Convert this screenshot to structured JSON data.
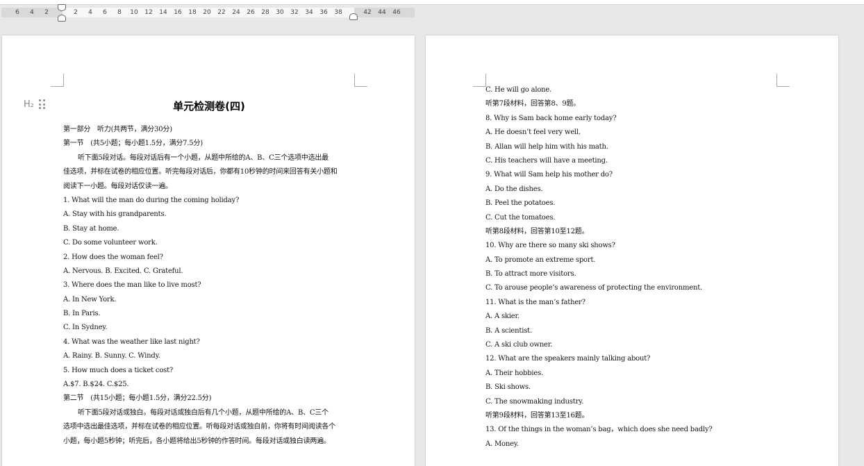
{
  "ruler": {
    "ticks": [
      "6",
      "4",
      "2",
      "2",
      "4",
      "6",
      "8",
      "10",
      "12",
      "14",
      "16",
      "18",
      "20",
      "22",
      "24",
      "26",
      "28",
      "30",
      "32",
      "34",
      "36",
      "38",
      "42",
      "44",
      "46"
    ]
  },
  "page1": {
    "heading_control": "H₂",
    "title": "单元检测卷(四)",
    "lines": [
      "第一部分　听力(共两节，满分30分)",
      "第一节　(共5小题；每小题1.5分，满分7.5分)",
      "听下面5段对话。每段对话后有一个小题，从题中所给的A、B、C三个选项中选出最",
      "佳选项，并标在试卷的相应位置。听完每段对话后，你都有10秒钟的时间来回答有关小题和",
      "阅读下一小题。每段对话仅读一遍。",
      "1.  What will the man do during the coming holiday?",
      "A.  Stay with his grandparents.",
      "B.  Stay at home.",
      "C.  Do some volunteer work.",
      "2.  How does the woman feel?",
      "A.  Nervous.    B.  Excited.    C.  Grateful.",
      "3.  Where does the man like to live most?",
      "A.  In New York.",
      "B.  In Paris.",
      "C.  In Sydney.",
      "4.  What was the weather like last night?",
      "A.  Rainy.    B.  Sunny.    C.  Windy.",
      "5.  How much does a ticket cost?",
      "A.$7.    B.$24.    C.$25.",
      "第二节　(共15小题；每小题1.5分，满分22.5分)",
      "听下面5段对话或独白。每段对话或独白后有几个小题，从题中所给的A、B、C三个",
      "选项中选出最佳选项，并标在试卷的相应位置。听每段对话或独白前，你将有时间阅读各个",
      "小题，每小题5秒钟；听完后，各小题将给出5秒钟的作答时间。每段对话或独白读两遍。"
    ]
  },
  "page2": {
    "lines": [
      "C.  He will go alone.",
      "听第7段材料，回答第8、9题。",
      "8.  Why is Sam back home early today?",
      "A.  He doesn’t feel very well.",
      "B.  Allan will help him with his math.",
      "C.  His teachers will have a meeting.",
      "9.  What will Sam help his mother do?",
      "A.  Do the dishes.",
      "B.  Peel the potatoes.",
      "C.  Cut the tomatoes.",
      "听第8段材料，回答第10至12题。",
      "10.  Why are there so many ski shows?",
      "A.  To promote an extreme sport.",
      "B.  To attract more visitors.",
      "C.  To arouse people’s awareness of protecting the environment.",
      "11.  What is the man’s father?",
      "A.  A skier.",
      "B.  A scientist.",
      "C.  A ski club owner.",
      "12.  What are the speakers mainly talking about?",
      "A.  Their hobbies.",
      "B.  Ski shows.",
      "C.  The snowmaking industry.",
      "听第9段材料，回答第13至16题。",
      "13.  Of the things in the woman’s bag，which does she need badly?",
      "A.  Money."
    ]
  }
}
